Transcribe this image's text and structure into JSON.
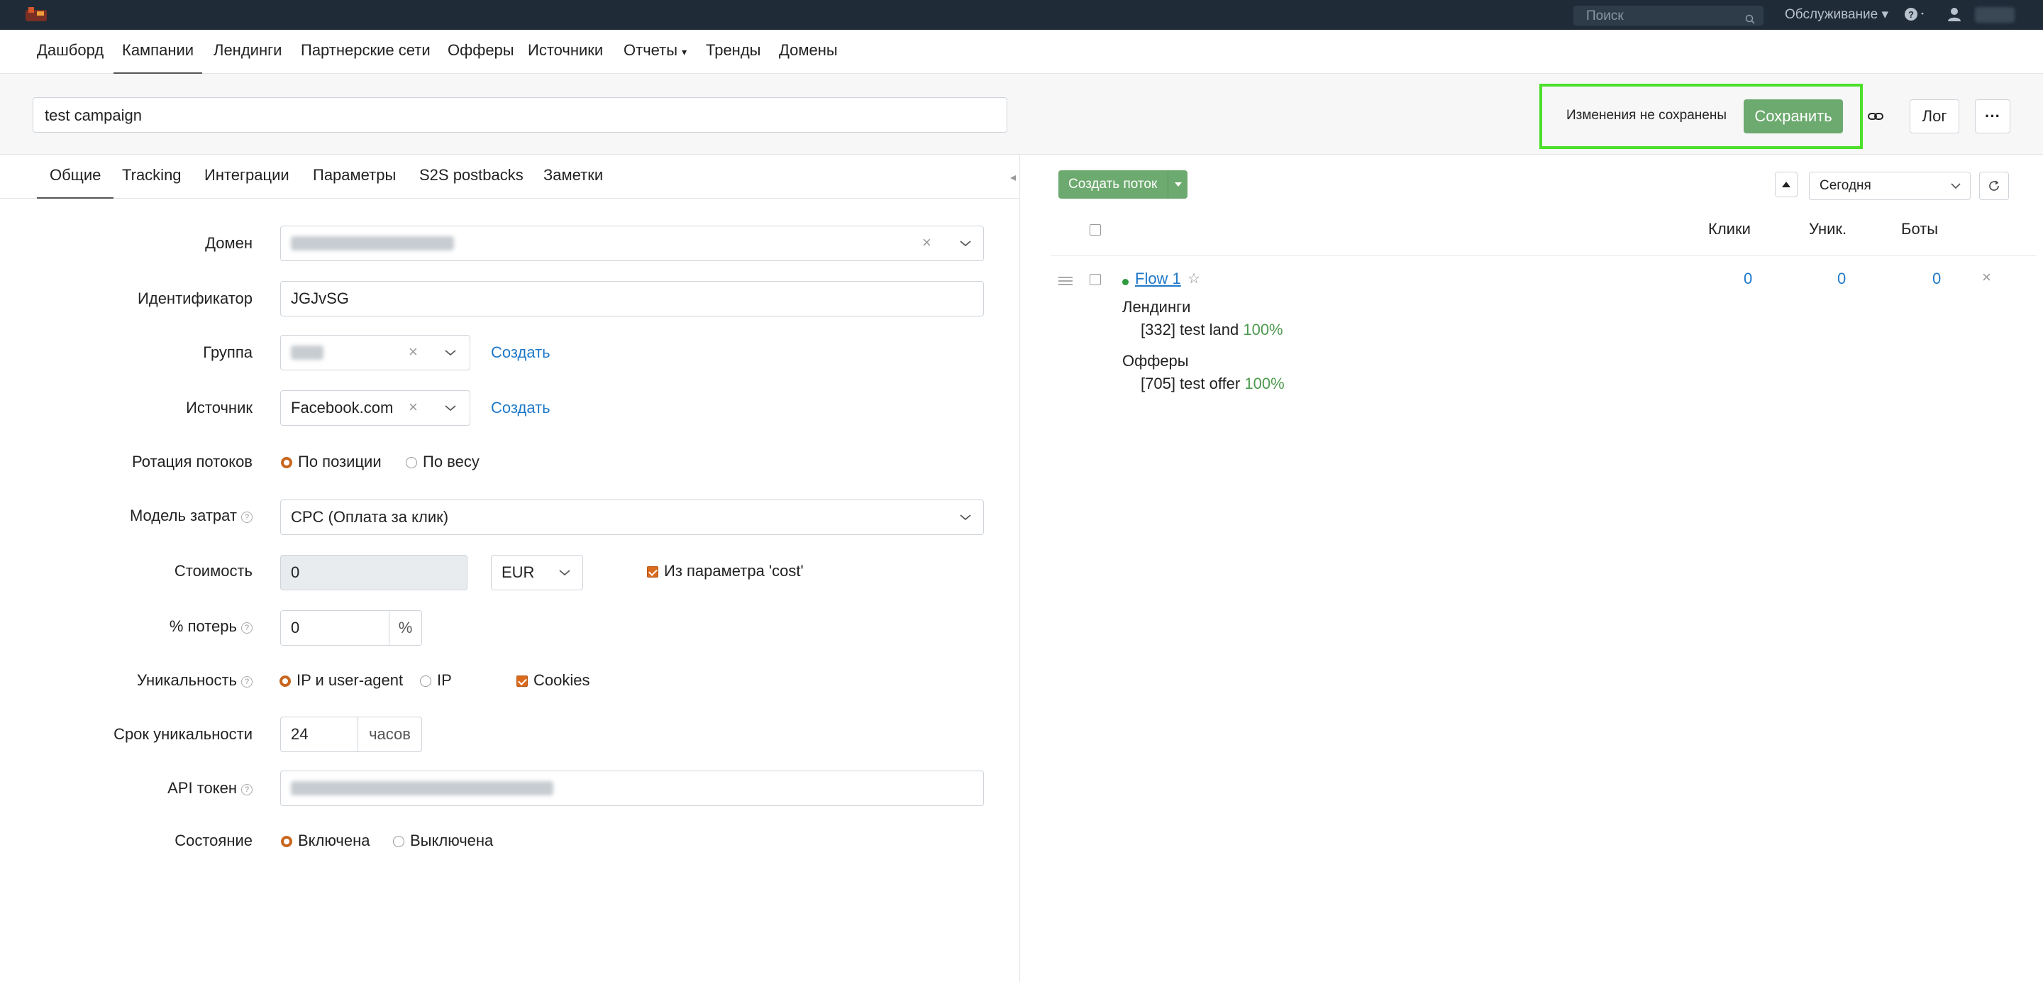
{
  "topbar": {
    "search_placeholder": "Поиск",
    "maintenance_label": "Обслуживание",
    "help_icon": "question-circle-icon",
    "user_icon": "user-icon"
  },
  "nav": {
    "items": [
      "Дашборд",
      "Кампании",
      "Лендинги",
      "Партнерские сети",
      "Офферы",
      "Источники",
      "Отчеты",
      "Тренды",
      "Домены"
    ],
    "active": "Кампании"
  },
  "header": {
    "campaign_name": "test campaign",
    "unsaved_text": "Изменения не сохранены",
    "save_label": "Сохранить",
    "log_label": "Лог",
    "more_label": "···",
    "highlight_color": "#4ce02b"
  },
  "tabs": [
    "Общие",
    "Tracking",
    "Интеграции",
    "Параметры",
    "S2S postbacks",
    "Заметки"
  ],
  "form": {
    "domain_label": "Домен",
    "identifier_label": "Идентификатор",
    "identifier_value": "JGJvSG",
    "group_label": "Группа",
    "group_create": "Создать",
    "source_label": "Источник",
    "source_value": "Facebook.com",
    "source_create": "Создать",
    "rotation_label": "Ротация потоков",
    "rotation_opt1": "По позиции",
    "rotation_opt2": "По весу",
    "cost_model_label": "Модель затрат",
    "cost_model_value": "CPC (Оплата за клик)",
    "cost_label": "Стоимость",
    "cost_value": "0",
    "currency_value": "EUR",
    "cost_param_label": "Из параметра 'cost'",
    "loss_label": "% потерь",
    "loss_value": "0",
    "loss_unit": "%",
    "uniq_label": "Уникальность",
    "uniq_opt1": "IP и user-agent",
    "uniq_opt2": "IP",
    "uniq_cookies": "Cookies",
    "uniq_period_label": "Срок уникальности",
    "uniq_period_value": "24",
    "uniq_period_unit": "часов",
    "api_label": "API токен",
    "state_label": "Состояние",
    "state_on": "Включена",
    "state_off": "Выключена"
  },
  "flows": {
    "create_label": "Создать поток",
    "period_value": "Сегодня",
    "columns": [
      "Клики",
      "Уник.",
      "Боты"
    ],
    "items": [
      {
        "name": "Flow 1",
        "clicks": "0",
        "uniques": "0",
        "bots": "0",
        "landings_label": "Лендинги",
        "landing": "[332] test land",
        "landing_pct": "100%",
        "offers_label": "Офферы",
        "offer": "[705] test offer",
        "offer_pct": "100%"
      }
    ]
  }
}
